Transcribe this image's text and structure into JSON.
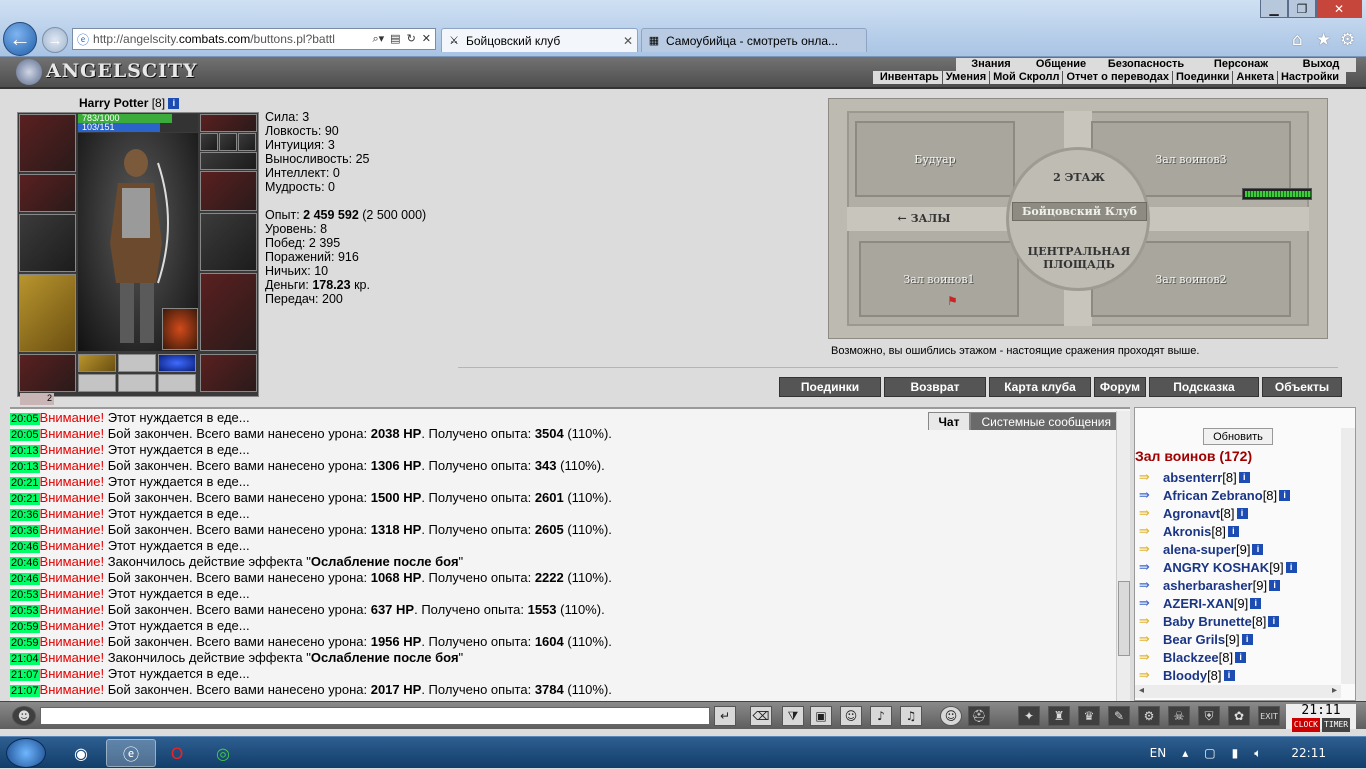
{
  "browser": {
    "url_prefix": "http://angelscity.",
    "url_domain": "combats.com",
    "url_suffix": "/buttons.pl?battl",
    "tabs": [
      {
        "label": "Бойцовский клуб",
        "active": true
      },
      {
        "label": "Самоубийца - смотреть онла...",
        "active": false
      }
    ]
  },
  "game": {
    "logo": "ANGELSCITY",
    "top_menu": [
      "Знания",
      "Общение",
      "Безопасность",
      "Персонаж",
      "Выход"
    ],
    "sub_menu": [
      "Инвентарь",
      "Умения",
      "Мой Скролл",
      "Отчет о переводах",
      "Поединки",
      "Анкета",
      "Настройки"
    ]
  },
  "character": {
    "name": "Harry Potter",
    "level": "[8]",
    "hp_text": "783/1000",
    "hp_fraction": 0.783,
    "mp_text": "103/151",
    "mp_fraction": 0.68,
    "gift_count": "2",
    "stats": [
      {
        "label": "Сила:",
        "value": "3"
      },
      {
        "label": "Ловкость:",
        "value": "90"
      },
      {
        "label": "Интуиция:",
        "value": "3"
      },
      {
        "label": "Выносливость:",
        "value": "25"
      },
      {
        "label": "Интеллект:",
        "value": "0"
      },
      {
        "label": "Мудрость:",
        "value": "0"
      }
    ],
    "exp_label": "Опыт:",
    "exp_value": "2 459 592",
    "exp_next": "(2 500 000)",
    "level_label": "Уровень:",
    "level_value": "8",
    "wins_label": "Побед:",
    "wins_value": "2 395",
    "losses_label": "Поражений:",
    "losses_value": "916",
    "draws_label": "Ничьих:",
    "draws_value": "10",
    "money_label": "Деньги:",
    "money_value": "178.23",
    "money_unit": "кр.",
    "transfers_label": "Передач:",
    "transfers_value": "200"
  },
  "map": {
    "rooms": [
      "Будуар",
      "Зал воинов3",
      "Зал воинов1",
      "Зал воинов2"
    ],
    "floor_label": "2 ЭТАЖ",
    "club_label": "Бойцовский Клуб",
    "halls_label": "← ЗАЛЫ",
    "center_label_1": "ЦЕНТРАЛЬНАЯ",
    "center_label_2": "ПЛОЩАДЬ",
    "note": "Возможно, вы ошиблись этажом - настоящие сражения проходят выше."
  },
  "actions": [
    "Поединки",
    "Возврат",
    "Карта клуба",
    "Форум",
    "Подсказка",
    "Объекты"
  ],
  "chat": {
    "tabs": [
      "Чат",
      "Системные сообщения"
    ],
    "attention": "Внимание!",
    "lines": [
      {
        "time": "20:05",
        "text": "Этот нуждается в еде..."
      },
      {
        "time": "20:05",
        "text": "Бой закончен. Всего вами нанесено урона: ",
        "dmg": "2038 HP",
        "mid": ". Получено опыта: ",
        "exp": "3504",
        "tail": " (110%)."
      },
      {
        "time": "20:13",
        "text": "Этот нуждается в еде..."
      },
      {
        "time": "20:13",
        "text": "Бой закончен. Всего вами нанесено урона: ",
        "dmg": "1306 HP",
        "mid": ". Получено опыта: ",
        "exp": "343",
        "tail": " (110%)."
      },
      {
        "time": "20:21",
        "text": "Этот нуждается в еде..."
      },
      {
        "time": "20:21",
        "text": "Бой закончен. Всего вами нанесено урона: ",
        "dmg": "1500 HP",
        "mid": ". Получено опыта: ",
        "exp": "2601",
        "tail": " (110%)."
      },
      {
        "time": "20:36",
        "text": "Этот нуждается в еде..."
      },
      {
        "time": "20:36",
        "text": "Бой закончен. Всего вами нанесено урона: ",
        "dmg": "1318 HP",
        "mid": ". Получено опыта: ",
        "exp": "2605",
        "tail": " (110%)."
      },
      {
        "time": "20:46",
        "text": "Этот нуждается в еде..."
      },
      {
        "time": "20:46",
        "text": "Закончилось действие эффекта \"",
        "dmg": "Ослабление после боя",
        "mid": "\"",
        "exp": "",
        "tail": ""
      },
      {
        "time": "20:46",
        "text": "Бой закончен. Всего вами нанесено урона: ",
        "dmg": "1068 HP",
        "mid": ". Получено опыта: ",
        "exp": "2222",
        "tail": " (110%)."
      },
      {
        "time": "20:53",
        "text": "Этот нуждается в еде..."
      },
      {
        "time": "20:53",
        "text": "Бой закончен. Всего вами нанесено урона: ",
        "dmg": "637 HP",
        "mid": ". Получено опыта: ",
        "exp": "1553",
        "tail": " (110%)."
      },
      {
        "time": "20:59",
        "text": "Этот нуждается в еде..."
      },
      {
        "time": "20:59",
        "text": "Бой закончен. Всего вами нанесено урона: ",
        "dmg": "1956 HP",
        "mid": ". Получено опыта: ",
        "exp": "1604",
        "tail": " (110%)."
      },
      {
        "time": "21:04",
        "text": "Закончилось действие эффекта \"",
        "dmg": "Ослабление после боя",
        "mid": "\"",
        "exp": "",
        "tail": ""
      },
      {
        "time": "21:07",
        "text": "Этот нуждается в еде..."
      },
      {
        "time": "21:07",
        "text": "Бой закончен. Всего вами нанесено урона: ",
        "dmg": "2017 HP",
        "mid": ". Получено опыта: ",
        "exp": "3784",
        "tail": " (110%)."
      }
    ]
  },
  "online": {
    "refresh_label": "Обновить",
    "room_title": "Зал воинов (172)",
    "users": [
      {
        "name": "absenterr",
        "level": "[8]",
        "team": "gold"
      },
      {
        "name": "African Zebrano",
        "level": "[8]",
        "team": "blue"
      },
      {
        "name": "Agronavt",
        "level": "[8]",
        "team": "gold"
      },
      {
        "name": "Akronis",
        "level": "[8]",
        "team": "gold"
      },
      {
        "name": "alena-super",
        "level": "[9]",
        "team": "gold"
      },
      {
        "name": "ANGRY KOSHAK",
        "level": "[9]",
        "team": "blue"
      },
      {
        "name": "asherbarasher",
        "level": "[9]",
        "team": "blue"
      },
      {
        "name": "AZERI-XAN",
        "level": "[9]",
        "team": "blue"
      },
      {
        "name": "Baby Brunette",
        "level": "[8]",
        "team": "gold"
      },
      {
        "name": "Bear Grils",
        "level": "[9]",
        "team": "gold"
      },
      {
        "name": "Blackzee",
        "level": "[8]",
        "team": "gold"
      },
      {
        "name": "Bloody",
        "level": "[8]",
        "team": "gold"
      }
    ]
  },
  "clock": {
    "time": "21:11",
    "label_a": "CLOCK",
    "label_b": "TIMER",
    "exit": "EXIT"
  },
  "taskbar": {
    "lang": "EN",
    "time": "22:11"
  }
}
